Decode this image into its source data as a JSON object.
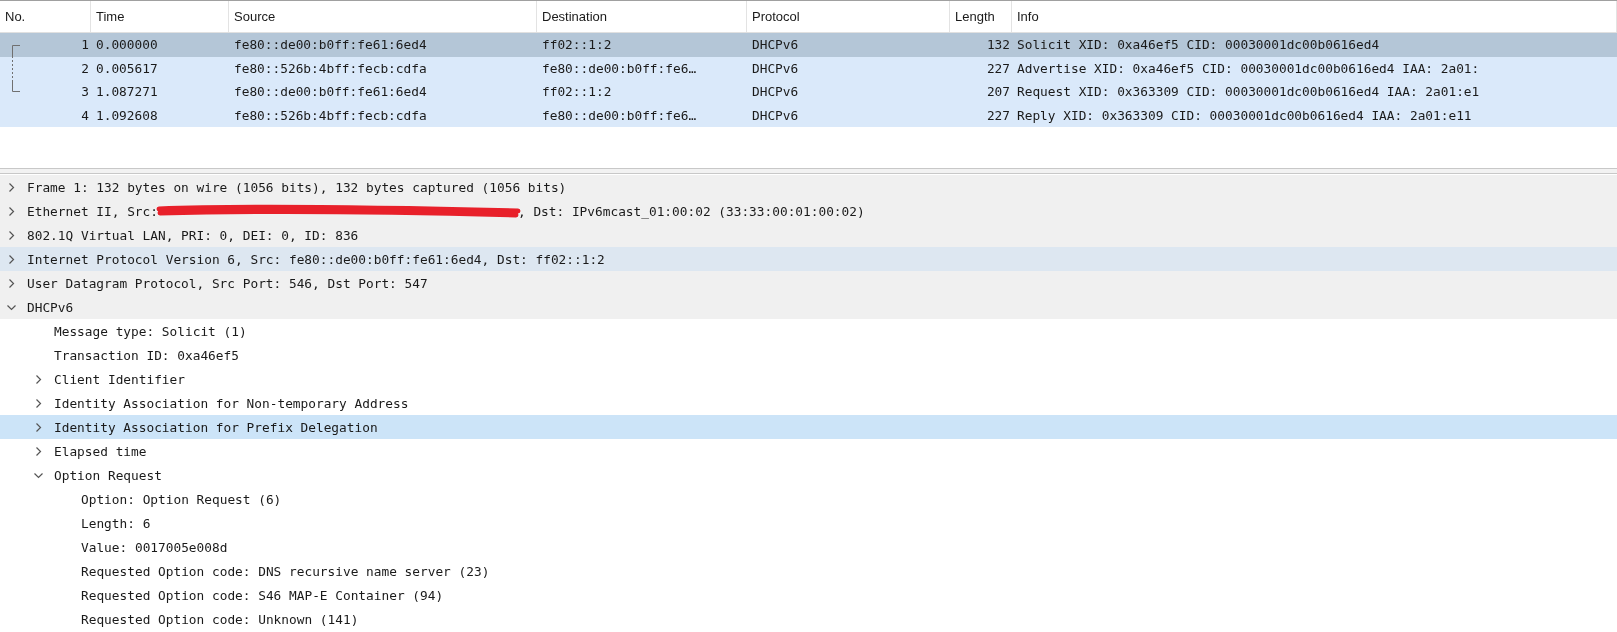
{
  "packet_list": {
    "columns": [
      "No.",
      "Time",
      "Source",
      "Destination",
      "Protocol",
      "Length",
      "Info"
    ],
    "rows": [
      {
        "cells": [
          "1",
          "0.000000",
          "fe80::de00:b0ff:fe61:6ed4",
          "ff02::1:2",
          "DHCPv6",
          "132",
          "Solicit XID: 0xa46ef5 CID: 00030001dc00b0616ed4"
        ],
        "selected": true,
        "kind": "first"
      },
      {
        "cells": [
          "2",
          "0.005617",
          "fe80::526b:4bff:fecb:cdfa",
          "fe80::de00:b0ff:fe6…",
          "DHCPv6",
          "227",
          "Advertise XID: 0xa46ef5 CID: 00030001dc00b0616ed4 IAA: 2a01:"
        ],
        "selected": false,
        "kind": "middle"
      },
      {
        "cells": [
          "3",
          "1.087271",
          "fe80::de00:b0ff:fe61:6ed4",
          "ff02::1:2",
          "DHCPv6",
          "207",
          "Request XID: 0x363309 CID: 00030001dc00b0616ed4 IAA: 2a01:e1"
        ],
        "selected": false,
        "kind": "last"
      },
      {
        "cells": [
          "4",
          "1.092608",
          "fe80::526b:4bff:fecb:cdfa",
          "fe80::de00:b0ff:fe6…",
          "DHCPv6",
          "227",
          "Reply XID: 0x363309 CID: 00030001dc00b0616ed4 IAA: 2a01:e11"
        ],
        "selected": false,
        "kind": "plain"
      }
    ]
  },
  "details": [
    {
      "segments": [
        {
          "text": "Frame 1: 132 bytes on wire (1056 bits), 132 bytes captured (1056 bits)"
        }
      ],
      "expanded": false,
      "selected": false,
      "hovered": false
    },
    {
      "segments": [
        {
          "text": "Ethernet II, Src: "
        },
        {
          "kind": "redaction"
        },
        {
          "text": ", Dst: IPv6mcast_01:00:02 (33:33:00:01:00:02)"
        }
      ],
      "expanded": false,
      "selected": false,
      "hovered": false
    },
    {
      "segments": [
        {
          "text": "802.1Q Virtual LAN, PRI: 0, DEI: 0, ID: 836"
        }
      ],
      "expanded": false,
      "selected": false,
      "hovered": false
    },
    {
      "segments": [
        {
          "text": "Internet Protocol Version 6, Src: fe80::de00:b0ff:fe61:6ed4, Dst: ff02::1:2"
        }
      ],
      "expanded": false,
      "selected": false,
      "hovered": true
    },
    {
      "segments": [
        {
          "text": "User Datagram Protocol, Src Port: 546, Dst Port: 547"
        }
      ],
      "expanded": false,
      "selected": false,
      "hovered": false
    },
    {
      "segments": [
        {
          "text": "DHCPv6"
        }
      ],
      "expanded": true,
      "selected": false,
      "hovered": false,
      "children": [
        {
          "segments": [
            {
              "text": "Message type: Solicit (1)"
            }
          ],
          "selected": false,
          "hovered": false
        },
        {
          "segments": [
            {
              "text": "Transaction ID: 0xa46ef5"
            }
          ],
          "selected": false,
          "hovered": false
        },
        {
          "segments": [
            {
              "text": "Client Identifier"
            }
          ],
          "expanded": false,
          "selected": false,
          "hovered": false
        },
        {
          "segments": [
            {
              "text": "Identity Association for Non-temporary Address"
            }
          ],
          "expanded": false,
          "selected": false,
          "hovered": false
        },
        {
          "segments": [
            {
              "text": "Identity Association for Prefix Delegation"
            }
          ],
          "expanded": false,
          "selected": true,
          "hovered": false
        },
        {
          "segments": [
            {
              "text": "Elapsed time"
            }
          ],
          "expanded": false,
          "selected": false,
          "hovered": false
        },
        {
          "segments": [
            {
              "text": "Option Request"
            }
          ],
          "expanded": true,
          "selected": false,
          "hovered": false,
          "children": [
            {
              "segments": [
                {
                  "text": "Option: Option Request (6)"
                }
              ],
              "selected": false,
              "hovered": false
            },
            {
              "segments": [
                {
                  "text": "Length: 6"
                }
              ],
              "selected": false,
              "hovered": false
            },
            {
              "segments": [
                {
                  "text": "Value: 0017005e008d"
                }
              ],
              "selected": false,
              "hovered": false
            },
            {
              "segments": [
                {
                  "text": "Requested Option code: DNS recursive name server (23)"
                }
              ],
              "selected": false,
              "hovered": false
            },
            {
              "segments": [
                {
                  "text": "Requested Option code: S46 MAP-E Container (94)"
                }
              ],
              "selected": false,
              "hovered": false
            },
            {
              "segments": [
                {
                  "text": "Requested Option code: Unknown (141)"
                }
              ],
              "selected": false,
              "hovered": false
            }
          ]
        }
      ]
    }
  ]
}
